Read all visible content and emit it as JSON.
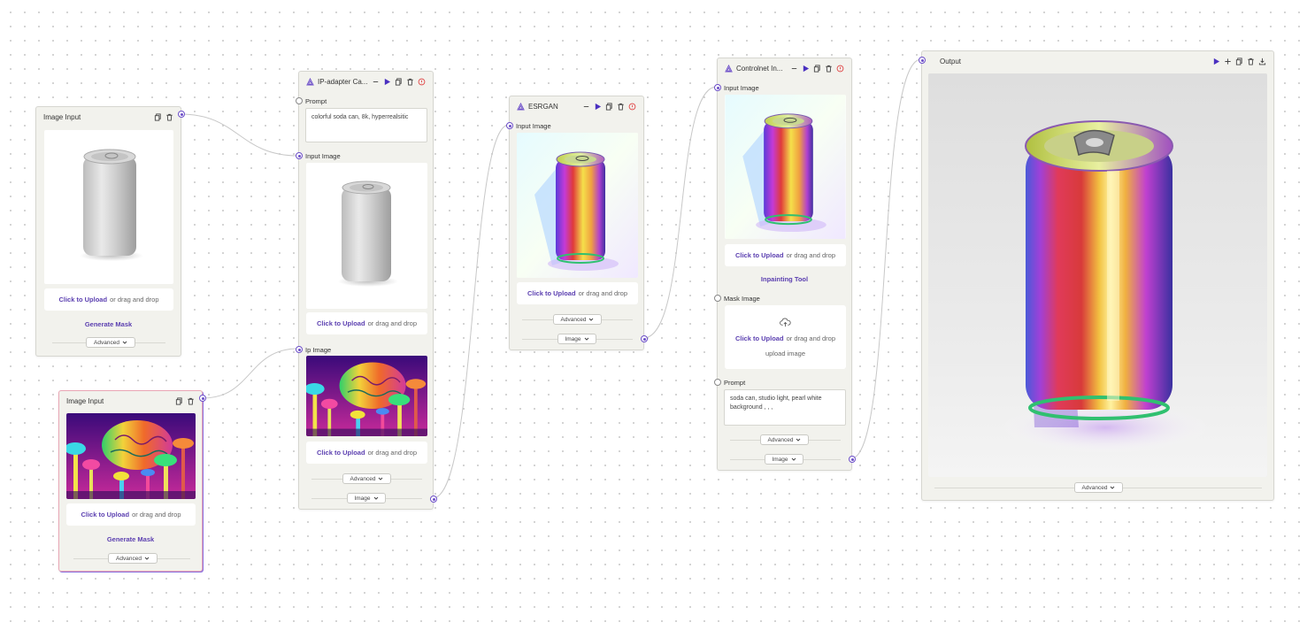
{
  "common": {
    "click_to_upload": "Click to Upload",
    "drag_drop": "or drag and drop",
    "advanced": "Advanced",
    "image_type": "Image",
    "generate_mask": "Generate Mask"
  },
  "nodes": {
    "image_input_1": {
      "title": "Image Input"
    },
    "image_input_2": {
      "title": "Image Input"
    },
    "ip_adapter": {
      "title": "IP-adapter Ca...",
      "prompt_label": "Prompt",
      "prompt_value": "colorful soda can, 8k, hyperrealsitic",
      "input_image_label": "Input Image",
      "ip_image_label": "Ip Image"
    },
    "esrgan": {
      "title": "ESRGAN",
      "input_image_label": "Input Image"
    },
    "controlnet": {
      "title": "Controlnet In...",
      "input_image_label": "Input Image",
      "inpainting_tool": "Inpainting Tool",
      "mask_image_label": "Mask Image",
      "upload_image_hint": "upload image",
      "prompt_label": "Prompt",
      "prompt_value": "soda can, studio light, pearl white background , , ,"
    },
    "output": {
      "title": "Output"
    }
  },
  "colors": {
    "accent": "#5b3fb0",
    "port": "#6d4fc9",
    "node_bg": "#f2f2ed",
    "danger": "#e04646"
  }
}
